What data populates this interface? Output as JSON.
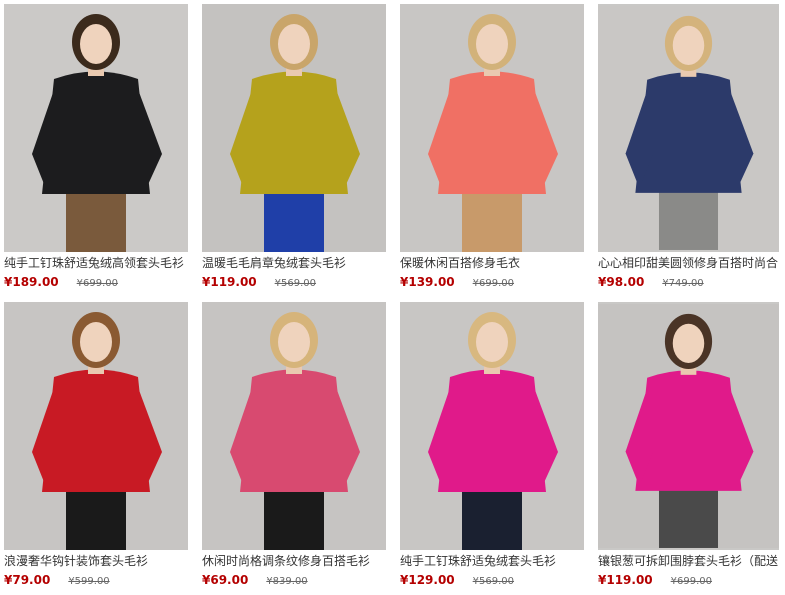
{
  "products": [
    {
      "title": "纯手工钉珠舒适兔绒高领套头毛衫",
      "price": "¥189.00",
      "old_price": "¥699.00",
      "colors": {
        "bg": "#cbc9c7",
        "sweater": "#1c1c1e",
        "bottom": "#7a5a3c",
        "hair": "#3b2a1c"
      }
    },
    {
      "title": "温暖毛毛肩章兔绒套头毛衫",
      "price": "¥119.00",
      "old_price": "¥569.00",
      "colors": {
        "bg": "#c4c2c0",
        "sweater": "#b5a21c",
        "bottom": "#1f3fa8",
        "hair": "#c9a56a"
      }
    },
    {
      "title": "保暖休闲百搭修身毛衣",
      "price": "¥139.00",
      "old_price": "¥699.00",
      "colors": {
        "bg": "#c8c6c4",
        "sweater": "#f07064",
        "bottom": "#c89a6a",
        "hair": "#d2b27a"
      }
    },
    {
      "title": "心心相印甜美圆领修身百搭时尚合",
      "price": "¥98.00",
      "old_price": "¥749.00",
      "colors": {
        "bg": "#c9c7c5",
        "sweater": "#2c3a6a",
        "bottom": "#8a8a88",
        "hair": "#d4b37c"
      }
    },
    {
      "title": "浪漫奢华钩针装饰套头毛衫",
      "price": "¥79.00",
      "old_price": "¥599.00",
      "colors": {
        "bg": "#c7c5c3",
        "sweater": "#c81a24",
        "bottom": "#1a1a1a",
        "hair": "#8a5a32"
      }
    },
    {
      "title": "休闲时尚格调条纹修身百搭毛衫",
      "price": "¥69.00",
      "old_price": "¥839.00",
      "colors": {
        "bg": "#c6c4c2",
        "sweater": "#d84a70",
        "bottom": "#1a1a1a",
        "hair": "#d6b47a"
      }
    },
    {
      "title": "纯手工钉珠舒适兔绒套头毛衫",
      "price": "¥129.00",
      "old_price": "¥569.00",
      "colors": {
        "bg": "#c8c6c4",
        "sweater": "#e01a8a",
        "bottom": "#1a2030",
        "hair": "#d8b880"
      }
    },
    {
      "title": "镶银葱可拆卸围脖套头毛衫（配送",
      "price": "¥119.00",
      "old_price": "¥699.00",
      "colors": {
        "bg": "#c5c3c1",
        "sweater": "#e01a8a",
        "bottom": "#4a4a4a",
        "hair": "#4a3426"
      }
    }
  ]
}
